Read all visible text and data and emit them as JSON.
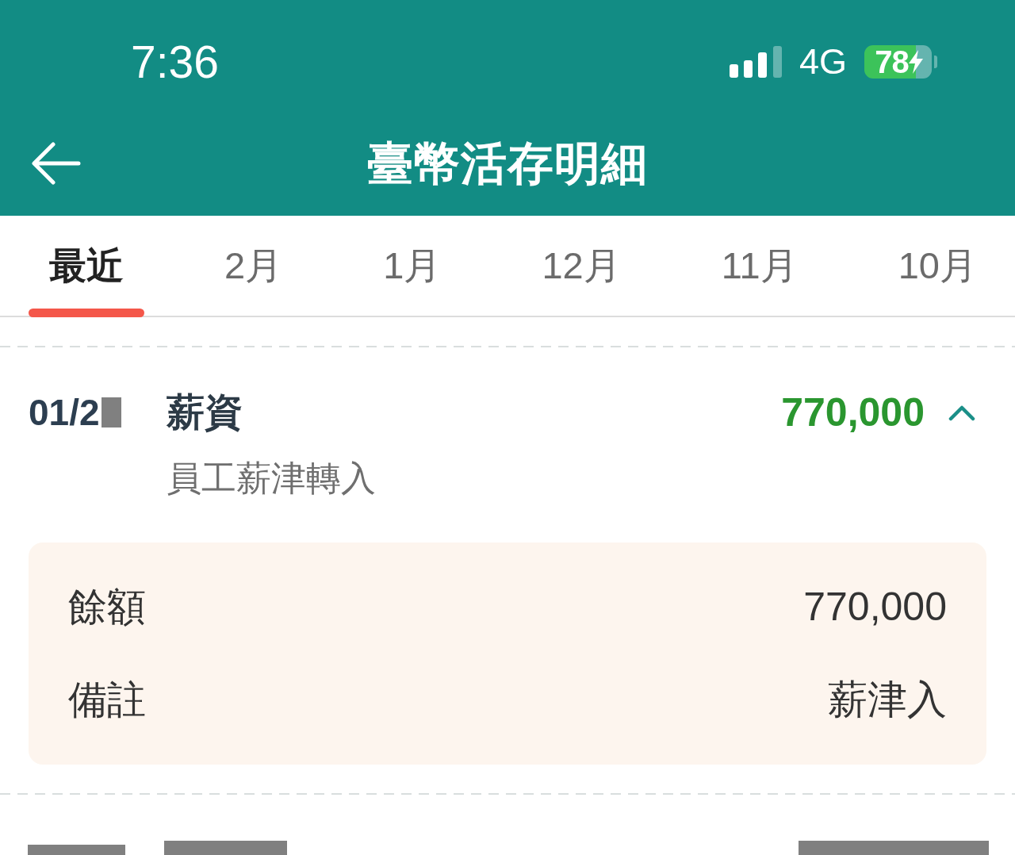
{
  "status_bar": {
    "time": "7:36",
    "network": "4G",
    "battery": "78",
    "charging": true
  },
  "header": {
    "title": "臺幣活存明細"
  },
  "tabs": [
    {
      "label": "最近",
      "selected": true
    },
    {
      "label": "2月",
      "selected": false
    },
    {
      "label": "1月",
      "selected": false
    },
    {
      "label": "12月",
      "selected": false
    },
    {
      "label": "11月",
      "selected": false
    },
    {
      "label": "10月",
      "selected": false
    }
  ],
  "transactions": [
    {
      "kind": "entry",
      "date": "01/2",
      "date_redacted": true,
      "title": "薪資",
      "description": "員工薪津轉入",
      "amount": "770,000",
      "expanded": true,
      "details": [
        {
          "label": "餘額",
          "value": "770,000"
        },
        {
          "label": "備註",
          "value": "薪津入"
        }
      ]
    },
    {
      "kind": "redacted"
    }
  ]
}
